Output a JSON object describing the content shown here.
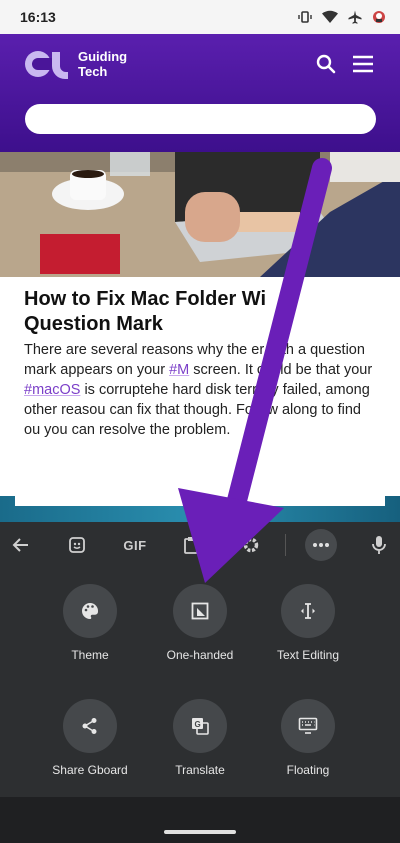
{
  "status_bar": {
    "time": "16:13",
    "icons": [
      "vibrate-icon",
      "wifi-icon",
      "airplane-icon",
      "notification-icon"
    ]
  },
  "header": {
    "logo_line1": "Guiding",
    "logo_line2": "Tech",
    "search_placeholder": "",
    "brand_color": "#4a1599"
  },
  "article": {
    "title": "How to Fix Mac Folder Wi",
    "title_line2": "Question Mark",
    "body_parts": {
      "p1": "There are several reasons why the ",
      "p1b": "er with a question mark appears on your ",
      "tag1": "#M",
      "p2": " screen. It could be that your ",
      "tag2": "#macOS",
      "p3": " is corrupte",
      "p3b": "he hard disk terribly failed, among other reas",
      "p3c": "ou can fix that though. Follow along to find ou",
      "p3d": " you can resolve the problem."
    }
  },
  "keyboard": {
    "toolbar": {
      "back_icon": "arrow-left-icon",
      "sticker_icon": "sticker-icon",
      "gif_label": "GIF",
      "clipboard_icon": "clipboard-icon",
      "settings_icon": "gear-icon",
      "more_icon": "more-horizontal-icon",
      "mic_icon": "mic-icon"
    },
    "options": [
      {
        "label": "Theme",
        "icon": "palette-icon"
      },
      {
        "label": "One-handed",
        "icon": "one-handed-icon"
      },
      {
        "label": "Text Editing",
        "icon": "text-cursor-icon"
      },
      {
        "label": "Share Gboard",
        "icon": "share-icon"
      },
      {
        "label": "Translate",
        "icon": "translate-icon"
      },
      {
        "label": "Floating",
        "icon": "keyboard-icon"
      }
    ]
  },
  "nav_bar": {
    "collapse_icon": "chevron-down-icon",
    "keyboard_switch_icon": "keyboard-icon"
  },
  "colors": {
    "keyboard_bg": "#2d2f31",
    "arrow": "#6a1fb8"
  }
}
